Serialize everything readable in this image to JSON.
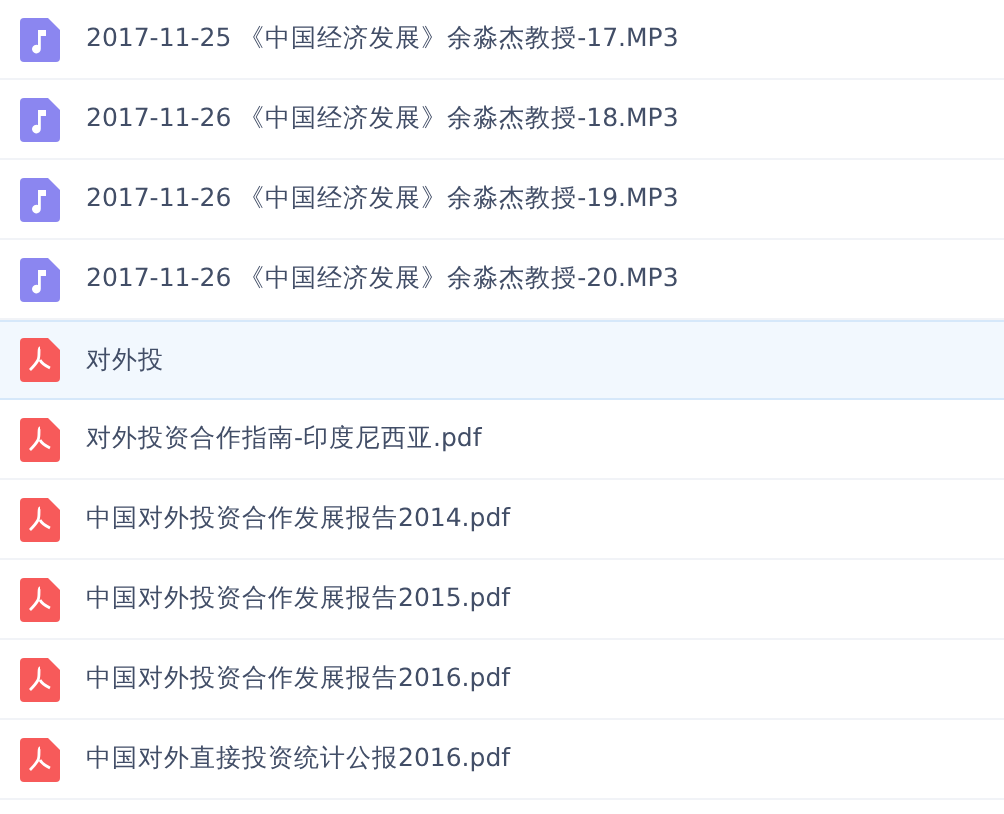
{
  "files": [
    {
      "kind": "audio",
      "name": "2017-11-25 《中国经济发展》余淼杰教授-17.MP3",
      "selected": false
    },
    {
      "kind": "audio",
      "name": "2017-11-26 《中国经济发展》余淼杰教授-18.MP3",
      "selected": false
    },
    {
      "kind": "audio",
      "name": "2017-11-26 《中国经济发展》余淼杰教授-19.MP3",
      "selected": false
    },
    {
      "kind": "audio",
      "name": "2017-11-26 《中国经济发展》余淼杰教授-20.MP3",
      "selected": false
    },
    {
      "kind": "pdf",
      "name": "对外投",
      "selected": true
    },
    {
      "kind": "pdf",
      "name": "对外投资合作指南-印度尼西亚.pdf",
      "selected": false
    },
    {
      "kind": "pdf",
      "name": "中国对外投资合作发展报告2014.pdf",
      "selected": false
    },
    {
      "kind": "pdf",
      "name": "中国对外投资合作发展报告2015.pdf",
      "selected": false
    },
    {
      "kind": "pdf",
      "name": "中国对外投资合作发展报告2016.pdf",
      "selected": false
    },
    {
      "kind": "pdf",
      "name": "中国对外直接投资统计公报2016.pdf",
      "selected": false
    }
  ]
}
